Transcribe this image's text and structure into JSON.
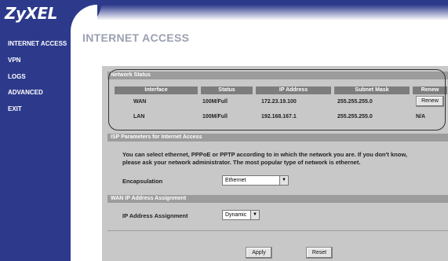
{
  "brand": "ZyXEL",
  "sidebar": {
    "items": [
      {
        "label": "INTERNET ACCESS"
      },
      {
        "label": "VPN"
      },
      {
        "label": "LOGS"
      },
      {
        "label": "ADVANCED"
      },
      {
        "label": "EXIT"
      }
    ]
  },
  "page_title": "INTERNET ACCESS",
  "network_status": {
    "section_title": "Network Status",
    "columns": [
      "Interface",
      "Status",
      "IP Address",
      "Subnet Mask",
      "Renew"
    ],
    "rows": [
      {
        "interface": "WAN",
        "status": "100M/Full",
        "ip": "172.23.19.100",
        "mask": "255.255.255.0",
        "renew": "Renew"
      },
      {
        "interface": "LAN",
        "status": "100M/Full",
        "ip": "192.168.167.1",
        "mask": "255.255.255.0",
        "renew": "N/A"
      }
    ]
  },
  "isp": {
    "section_title": "ISP Parameters for Internet Access",
    "description_line1": "You can select ethernet, PPPoE or PPTP according to in which the network you are. If you don't know,",
    "description_line2": "please ask your network administrator. The most popular type of network is ethernet.",
    "encapsulation_label": "Encapsulation",
    "encapsulation_value": "Ethernet"
  },
  "wan_ip": {
    "section_title": "WAN IP Address Assignment",
    "assignment_label": "IP Address Assignment",
    "assignment_value": "Dynamic"
  },
  "actions": {
    "apply": "Apply",
    "reset": "Reset"
  },
  "colors": {
    "sidebar": "#2d3a8c",
    "panel": "#c8c8c8",
    "section_bar": "#9c9c9c",
    "table_header": "#7d7d7d"
  }
}
